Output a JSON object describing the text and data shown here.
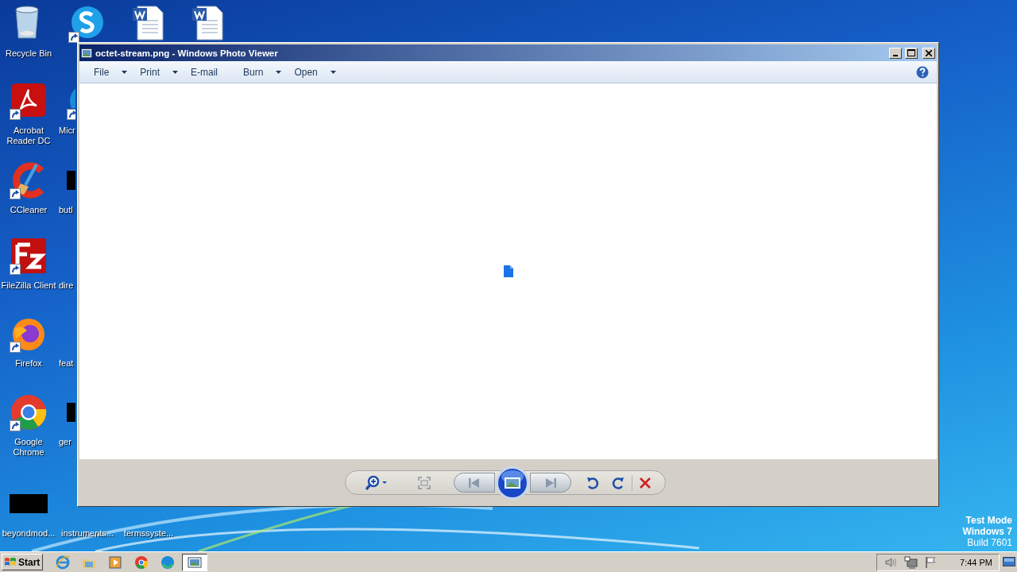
{
  "desktop": {
    "icons": [
      {
        "kind": "recycle-bin",
        "label": "Recycle Bin",
        "shortcut": false
      },
      {
        "kind": "acrobat",
        "label": "Acrobat Reader DC",
        "shortcut": true
      },
      {
        "kind": "ccleaner",
        "label": "CCleaner",
        "shortcut": true
      },
      {
        "kind": "filezilla",
        "label": "FileZilla Client",
        "shortcut": true
      },
      {
        "kind": "firefox",
        "label": "Firefox",
        "shortcut": true
      },
      {
        "kind": "chrome",
        "label": "Google Chrome",
        "shortcut": true
      },
      {
        "kind": "blank",
        "label": "beyondmod...",
        "shortcut": false
      },
      {
        "kind": "skype",
        "shortcut": true
      },
      {
        "kind": "edge",
        "label": "Micr",
        "shortcut": true
      },
      {
        "kind": "blank",
        "label": "butl",
        "shortcut": false
      },
      {
        "label": "dire"
      },
      {
        "label": "feat"
      },
      {
        "kind": "blank",
        "label": "ger",
        "shortcut": false
      },
      {
        "label": "instruments..."
      },
      {
        "kind": "word",
        "shortcut": false
      },
      {
        "label": "termssyste..."
      },
      {
        "kind": "word",
        "shortcut": false
      }
    ]
  },
  "os_notice": [
    "Test Mode",
    "Windows 7",
    "Build 7601"
  ],
  "window": {
    "title": "octet-stream.png - Windows Photo Viewer",
    "menu": [
      {
        "label": "File",
        "dropdown": true
      },
      {
        "label": "Print",
        "dropdown": true
      },
      {
        "label": "E-mail",
        "dropdown": false
      },
      {
        "label": "Burn",
        "dropdown": true
      },
      {
        "label": "Open",
        "dropdown": true
      }
    ],
    "controls": [
      {
        "kind": "zoom"
      },
      {
        "kind": "fit"
      },
      {
        "kind": "previous"
      },
      {
        "kind": "slideshow"
      },
      {
        "kind": "next"
      },
      {
        "kind": "rotate-ccw"
      },
      {
        "kind": "rotate-cw"
      },
      {
        "kind": "delete"
      }
    ]
  },
  "taskbar": {
    "start": "Start",
    "apps": [
      {
        "kind": "ie",
        "selected": false
      },
      {
        "kind": "explorer",
        "selected": false
      },
      {
        "kind": "media",
        "selected": false
      },
      {
        "kind": "chrome",
        "selected": false
      },
      {
        "kind": "edge",
        "selected": false
      },
      {
        "kind": "photo",
        "selected": true
      }
    ],
    "clock": "7:44 PM"
  }
}
